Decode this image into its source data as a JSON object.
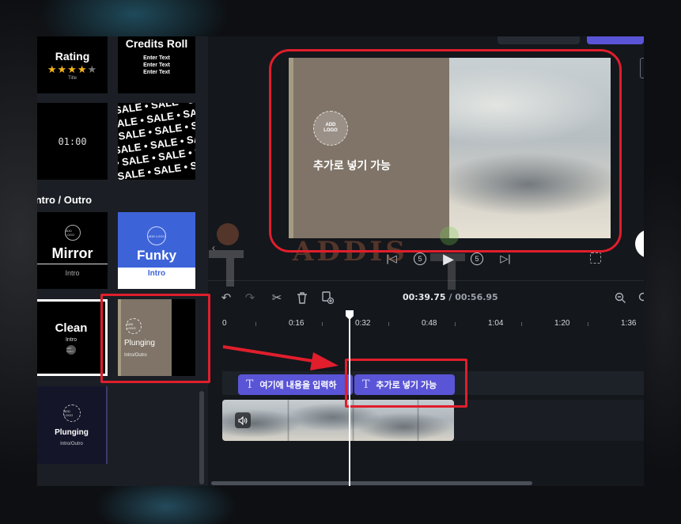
{
  "colors": {
    "accent_purple": "#5a55d6",
    "callout_red": "#e01e2c",
    "panel_bg": "#1b1f25",
    "app_bg": "#14171c",
    "funky_blue": "#3d63d8"
  },
  "left_panel": {
    "tiles": [
      {
        "title": "Rating",
        "subtitle": "Title",
        "stars": 4,
        "stars_total": 5
      },
      {
        "title": "Credits Roll",
        "lines": [
          "Enter Text",
          "Enter Text",
          "Enter Text"
        ]
      },
      {
        "title": "01:00"
      },
      {
        "title": "SALE",
        "pattern_text": "SALE • SALE • SALE • SALE"
      },
      {
        "title": "Mirror",
        "subtitle": "Intro",
        "logo": "ADD LOGO"
      },
      {
        "title": "Funky",
        "subtitle": "Intro",
        "logo": "ADD LOGO"
      },
      {
        "title": "Clean",
        "subtitle": "Intro",
        "logo": "ADD LOGO"
      },
      {
        "title": "Plunging",
        "subtitle": "Intro/Outro",
        "logo": "ADD LOGO"
      },
      {
        "title": "Plunging",
        "subtitle": "Intro/Outro",
        "logo": "ADD LOGO"
      }
    ],
    "section_title": "Intro / Outro"
  },
  "preview": {
    "logo_text": "ADD LOGO",
    "caption": "추가로 넣기 가능"
  },
  "playback": {
    "rewind_seconds": "5",
    "forward_seconds": "5"
  },
  "timeline": {
    "current_time": "00:39.75",
    "separator": " / ",
    "total_time": "00:56.95",
    "ruler_ticks": [
      "0",
      "0:16",
      "0:32",
      "0:48",
      "1:04",
      "1:20",
      "1:36"
    ],
    "text_clips": [
      {
        "label": "여기에 내용을 입력하"
      },
      {
        "label": "추가로 넣기 가능"
      }
    ]
  },
  "icons": {
    "undo": "undo-icon",
    "redo": "redo-icon",
    "cut": "scissors-icon",
    "delete": "trash-icon",
    "duplicate": "duplicate-icon",
    "zoom_out": "zoom-out-icon",
    "volume": "volume-icon",
    "text": "text-icon"
  }
}
